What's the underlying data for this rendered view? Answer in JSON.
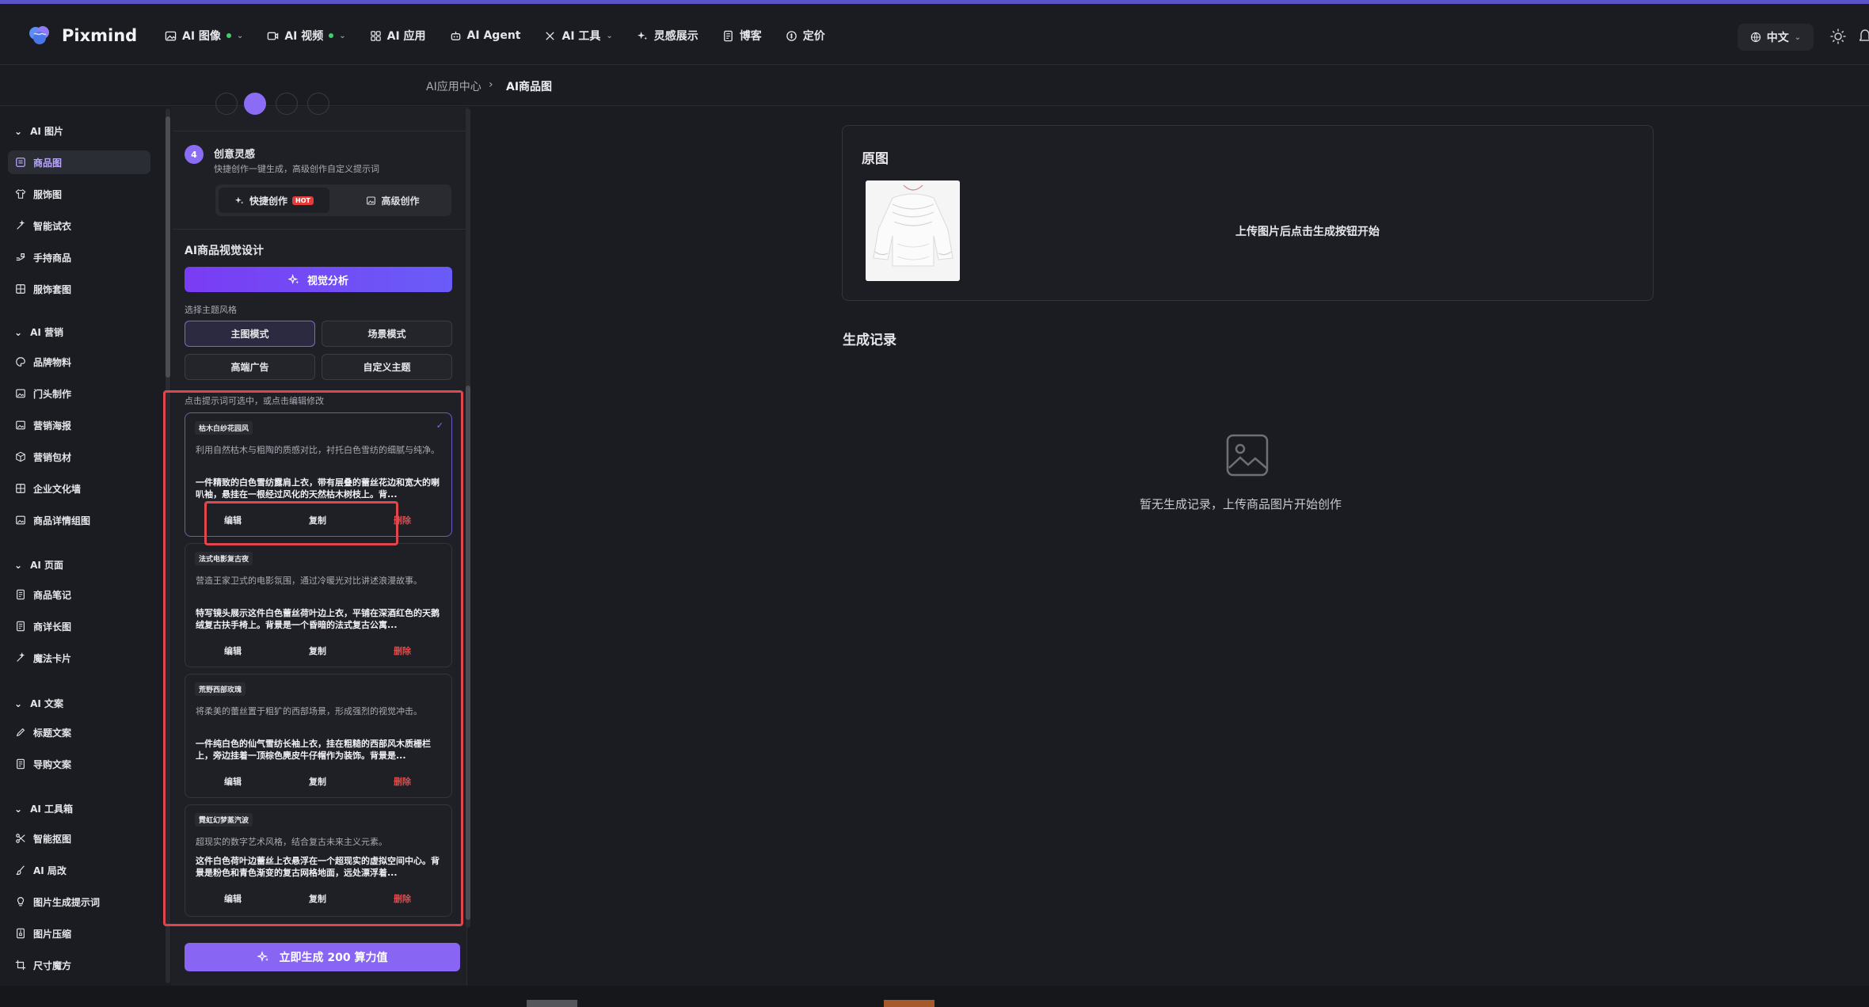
{
  "app": {
    "name": "Pixmind"
  },
  "nav": [
    {
      "label": "AI 图像",
      "dot": true,
      "chevron": true
    },
    {
      "label": "AI 视频",
      "dot": true,
      "chevron": true
    },
    {
      "label": "AI 应用"
    },
    {
      "label": "AI Agent"
    },
    {
      "label": "AI 工具",
      "chevron": true
    },
    {
      "label": "灵感展示"
    },
    {
      "label": "博客"
    },
    {
      "label": "定价"
    }
  ],
  "language": "中文",
  "breadcrumb": {
    "parent": "AI应用中心",
    "current": "AI商品图"
  },
  "sidebar": {
    "groups": [
      {
        "title": "AI 图片",
        "items": [
          "商品图",
          "服饰图",
          "智能试衣",
          "手持商品",
          "服饰套图"
        ]
      },
      {
        "title": "AI 营销",
        "items": [
          "品牌物料",
          "门头制作",
          "营销海报",
          "营销包材",
          "企业文化墙",
          "商品详情组图"
        ]
      },
      {
        "title": "AI 页面",
        "items": [
          "商品笔记",
          "商详长图",
          "魔法卡片"
        ]
      },
      {
        "title": "AI 文案",
        "items": [
          "标题文案",
          "导购文案"
        ]
      },
      {
        "title": "AI 工具箱",
        "items": [
          "智能抠图",
          "AI 局改",
          "图片生成提示词",
          "图片压缩",
          "尺寸魔方"
        ]
      }
    ],
    "active": "商品图"
  },
  "step": {
    "number": "4",
    "title": "创意灵感",
    "subtitle": "快捷创作一键生成，高级创作自定义提示词"
  },
  "tabs": {
    "quick": "快捷创作",
    "hot": "HOT",
    "advanced": "高级创作"
  },
  "visual": {
    "title": "AI商品视觉设计",
    "analyze_button": "视觉分析",
    "style_label": "选择主题风格"
  },
  "styles": [
    "主图模式",
    "场景模式",
    "高端广告",
    "自定义主题"
  ],
  "prompt_hint": "点击提示词可选中，或点击编辑修改",
  "cards": [
    {
      "tag": "枯木白纱花园风",
      "desc": "利用自然枯木与粗陶的质感对比，衬托白色雪纺的细腻与纯净。",
      "body": "一件精致的白色雪纺露肩上衣，带有层叠的蕾丝花边和宽大的喇叭袖，悬挂在一根经过风化的天然枯木树枝上。背...",
      "selected": true
    },
    {
      "tag": "法式电影复古夜",
      "desc": "营造王家卫式的电影氛围，通过冷暖光对比讲述浪漫故事。",
      "body": "特写镜头展示这件白色蕾丝荷叶边上衣，平铺在深酒红色的天鹅绒复古扶手椅上。背景是一个昏暗的法式复古公寓...",
      "selected": false
    },
    {
      "tag": "荒野西部玫瑰",
      "desc": "将柔美的蕾丝置于粗犷的西部场景，形成强烈的视觉冲击。",
      "body": "一件纯白色的仙气雪纺长袖上衣，挂在粗糙的西部风木质栅栏上，旁边挂着一顶棕色麂皮牛仔帽作为装饰。背景是...",
      "selected": false
    },
    {
      "tag": "霓虹幻梦蒸汽波",
      "desc": "超现实的数字艺术风格，结合复古未来主义元素。",
      "body": "这件白色荷叶边蕾丝上衣悬浮在一个超现实的虚拟空间中心。背景是粉色和青色渐变的复古网格地面，远处漂浮着...",
      "selected": false
    }
  ],
  "card_actions": {
    "edit": "编辑",
    "copy": "复制",
    "delete": "删除"
  },
  "generate_button": "立即生成 200 算力值",
  "main": {
    "original_title": "原图",
    "upload_hint": "上传图片后点击生成按钮开始",
    "records_title": "生成记录",
    "empty_text": "暂无生成记录，上传商品图片开始创作"
  },
  "colors": {
    "accent": "#8b6cf5",
    "highlight": "#e0474c",
    "danger": "#e34949"
  }
}
